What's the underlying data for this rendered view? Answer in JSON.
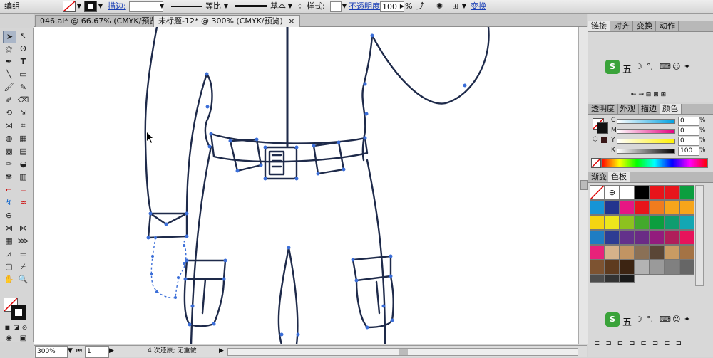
{
  "control_bar": {
    "object_label": "编组",
    "stroke_label": "描边:",
    "stroke_style_label": "等比",
    "brush_label": "基本",
    "style_label": "样式:",
    "opacity_label": "不透明度:",
    "opacity_value": "100",
    "opacity_unit": "%",
    "transform_label": "变换"
  },
  "tabs": [
    {
      "label": "046.ai* @ 66.67% (CMYK/预览)",
      "close": "×"
    },
    {
      "label": "未标题-12* @ 300% (CMYK/预览)",
      "close": "×"
    }
  ],
  "status_bar": {
    "zoom": "300%",
    "page": "1",
    "message": "4 次还原; 无重做"
  },
  "panels": {
    "top_tabs": [
      "链接",
      "对齐",
      "变换",
      "动作"
    ],
    "color_tabs": [
      "透明度",
      "外观",
      "描边",
      "颜色"
    ],
    "swatch_tabs": [
      "渐变",
      "色板"
    ],
    "ime_char": "五",
    "color_channels": [
      {
        "label": "C",
        "value": "0",
        "unit": "%"
      },
      {
        "label": "M",
        "value": "0",
        "unit": "%"
      },
      {
        "label": "Y",
        "value": "0",
        "unit": "%"
      },
      {
        "label": "K",
        "value": "100",
        "unit": "%"
      }
    ],
    "swatches": [
      "#ffffff",
      "#000000",
      "#e8141a",
      "#e7151c",
      "#0b9e3f",
      "#1794d6",
      "#23348e",
      "#e61683",
      "#e8141a",
      "#f07c1e",
      "#f6a51b",
      "#f6a51b",
      "#f5d511",
      "#ede61c",
      "#8dc21f",
      "#43a92c",
      "#0b9e3f",
      "#0f9c6f",
      "#13a7b3",
      "#1f7dc3",
      "#2d3c93",
      "#63318b",
      "#6a2c85",
      "#931c7d",
      "#b01e5a",
      "#e6135b",
      "#e8227a",
      "#d6b28a",
      "#c19463",
      "#8a7056",
      "#5a4636",
      "#c99b63",
      "#a47345",
      "#7d5331",
      "#5e3b1f",
      "#3c2412",
      "#b3b3b3",
      "#9a9a9a",
      "#808080",
      "#666666",
      "#4d4d4d",
      "#333333",
      "#1a1a1a"
    ]
  },
  "colors": {
    "path_stroke": "#1e2a4a",
    "anchor": "#3b6ed8",
    "panel_bg": "#d8d8d8"
  }
}
